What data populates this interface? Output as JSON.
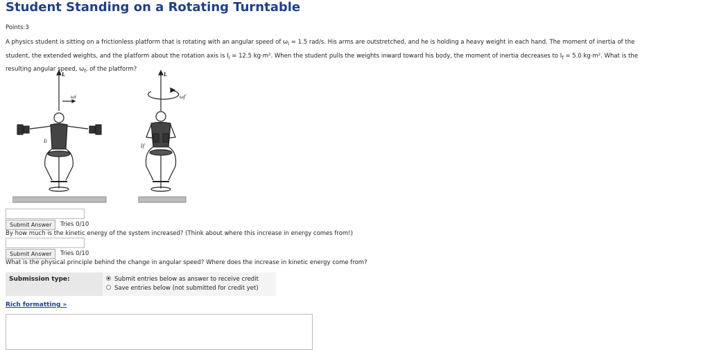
{
  "header": {
    "title": "Student Standing on a Rotating Turntable"
  },
  "points": "Points:3",
  "problem": {
    "line1": "A physics student is sitting on a frictionless platform that is rotating with an angular speed of ω",
    "sub_i": "i",
    "line1b": " = 1.5 rad/s. His arms are outstretched, and he is holding a heavy weight in each hand. The moment of inertia of the",
    "line2a": "student, the extended weights, and the platform about the rotation axis is I",
    "line2b": " = 12.5 kg·m². When the student pulls the weights inward toward his body, the moment of inertia decreases to I",
    "sub_f": "f",
    "line2c": " = 5.0 kg·m². What is the",
    "line3a": "resulting angular speed, ω",
    "line3b": ", of the platform?"
  },
  "figure": {
    "axis_label": "L",
    "omega_i": "ωi",
    "omega_f": "ωf",
    "inertia_i": "Ii",
    "inertia_f": "If"
  },
  "parts": [
    {
      "submit_label": "Submit Answer",
      "tries": "Tries 0/10"
    },
    {
      "question": "By how much is the kinetic energy of the system increased? (Think about where this increase in energy comes from!)",
      "submit_label": "Submit Answer",
      "tries": "Tries 0/10"
    },
    {
      "question": "What is the physical principle behind the change in angular speed? Where does the increase in kinetic energy come from?"
    }
  ],
  "submission": {
    "label": "Submission type:",
    "options": [
      {
        "label": "Submit entries below as answer to receive credit",
        "checked": true
      },
      {
        "label": "Save entries below (not submitted for credit yet)",
        "checked": false
      }
    ]
  },
  "rich_formatting": "Rich formatting »"
}
